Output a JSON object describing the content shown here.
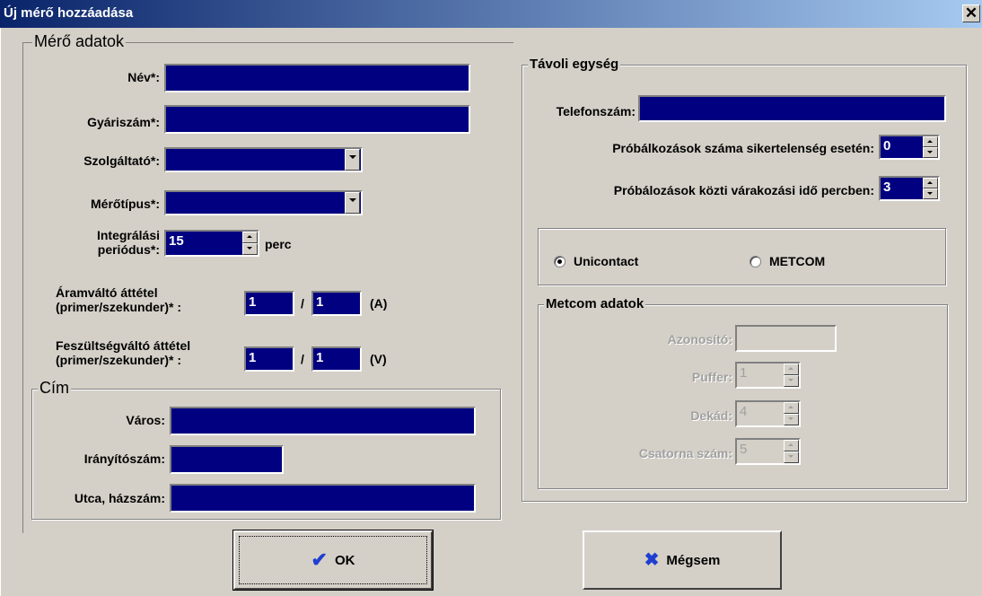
{
  "window": {
    "title": "Új mérő hozzáadása",
    "close_glyph": "✕"
  },
  "meter": {
    "legend": "Mérő adatok",
    "name_label": "Név*:",
    "name_value": "",
    "serial_label": "Gyáriszám*:",
    "serial_value": "",
    "provider_label": "Szolgáltató*:",
    "provider_value": "",
    "type_label": "Mérőtípus*:",
    "type_value": "",
    "integ_label_1": "Integrálási",
    "integ_label_2": "periódus*:",
    "integ_value": "15",
    "integ_unit": "perc",
    "ct_label_1": "Áramváltó áttétel",
    "ct_label_2": "(primer/szekunder)* :",
    "ct_primary": "1",
    "ct_secondary": "1",
    "ct_sep": "/",
    "ct_unit": "(A)",
    "vt_label_1": "Feszültségváltó áttétel",
    "vt_label_2": "(primer/szekunder)* :",
    "vt_primary": "1",
    "vt_secondary": "1",
    "vt_sep": "/",
    "vt_unit": "(V)"
  },
  "address": {
    "legend": "Cím",
    "city_label": "Város:",
    "city_value": "",
    "zip_label": "Irányítószám:",
    "zip_value": "",
    "street_label": "Utca, házszám:",
    "street_value": ""
  },
  "remote": {
    "legend": "Távoli egység",
    "phone_label": "Telefonszám:",
    "phone_value": "",
    "retries_label": "Próbálkozások száma sikertelenség esetén:",
    "retries_value": "0",
    "wait_label": "Próbálozások közti várakozási idő percben:",
    "wait_value": "3",
    "protocol_options": [
      "Unicontact",
      "METCOM"
    ],
    "protocol_selected": "Unicontact"
  },
  "metcom": {
    "legend": "Metcom adatok",
    "id_label": "Azonosító:",
    "id_value": "",
    "buffer_label": "Puffer:",
    "buffer_value": "1",
    "decade_label": "Dekád:",
    "decade_value": "4",
    "channel_label": "Csatorna szám:",
    "channel_value": "5"
  },
  "buttons": {
    "ok_label": "OK",
    "ok_icon": "check-icon",
    "cancel_label": "Mégsem",
    "cancel_icon": "x-icon"
  }
}
